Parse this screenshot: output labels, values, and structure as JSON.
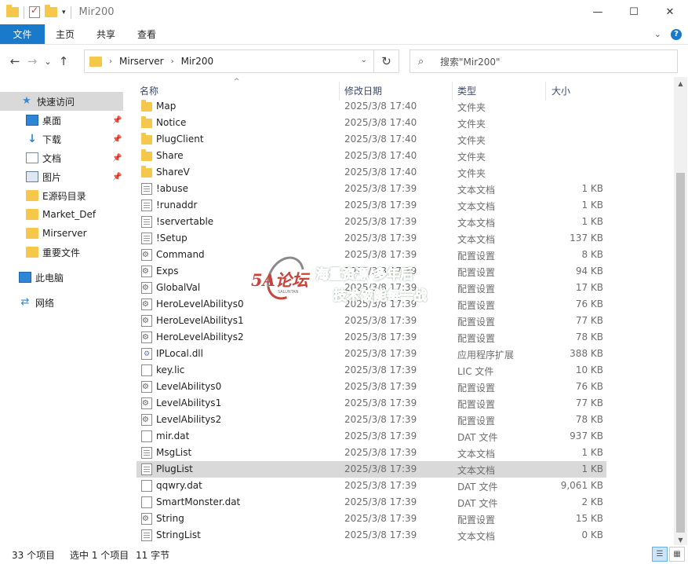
{
  "window": {
    "title": "Mir200",
    "minimize_glyph": "—",
    "maximize_glyph": "☐",
    "close_glyph": "✕"
  },
  "ribbon": {
    "tabs": [
      "文件",
      "主页",
      "共享",
      "查看"
    ],
    "accent_color": "#1979ca",
    "help_label": "?"
  },
  "nav": {
    "back": "←",
    "forward": "→",
    "recent": "⌄",
    "up": "↑"
  },
  "address": {
    "crumbs": [
      "Mirserver",
      "Mir200"
    ],
    "separator": "›"
  },
  "search": {
    "placeholder": "搜索\"Mir200\""
  },
  "sidebar": {
    "quick_access": "快速访问",
    "items": [
      {
        "label": "桌面",
        "icon": "desktop-icon",
        "pinned": true
      },
      {
        "label": "下载",
        "icon": "download-icon",
        "pinned": true
      },
      {
        "label": "文档",
        "icon": "document-icon",
        "pinned": true
      },
      {
        "label": "图片",
        "icon": "picture-icon",
        "pinned": true
      },
      {
        "label": "E源码目录",
        "icon": "folder-icon",
        "pinned": false
      },
      {
        "label": "Market_Def",
        "icon": "folder-icon",
        "pinned": false
      },
      {
        "label": "Mirserver",
        "icon": "folder-icon",
        "pinned": false
      },
      {
        "label": "重要文件",
        "icon": "folder-icon",
        "pinned": false
      }
    ],
    "this_pc": "此电脑",
    "network": "网络"
  },
  "columns": {
    "name": "名称",
    "date": "修改日期",
    "type": "类型",
    "size": "大小"
  },
  "files": [
    {
      "name": "Map",
      "date": "2025/3/8 17:40",
      "type": "文件夹",
      "size": "",
      "icon": "folder"
    },
    {
      "name": "Notice",
      "date": "2025/3/8 17:40",
      "type": "文件夹",
      "size": "",
      "icon": "folder"
    },
    {
      "name": "PlugClient",
      "date": "2025/3/8 17:40",
      "type": "文件夹",
      "size": "",
      "icon": "folder"
    },
    {
      "name": "Share",
      "date": "2025/3/8 17:40",
      "type": "文件夹",
      "size": "",
      "icon": "folder"
    },
    {
      "name": "ShareV",
      "date": "2025/3/8 17:40",
      "type": "文件夹",
      "size": "",
      "icon": "folder"
    },
    {
      "name": "!abuse",
      "date": "2025/3/8 17:39",
      "type": "文本文档",
      "size": "1 KB",
      "icon": "text"
    },
    {
      "name": "!runaddr",
      "date": "2025/3/8 17:39",
      "type": "文本文档",
      "size": "1 KB",
      "icon": "text"
    },
    {
      "name": "!servertable",
      "date": "2025/3/8 17:39",
      "type": "文本文档",
      "size": "1 KB",
      "icon": "text"
    },
    {
      "name": "!Setup",
      "date": "2025/3/8 17:39",
      "type": "文本文档",
      "size": "137 KB",
      "icon": "text"
    },
    {
      "name": "Command",
      "date": "2025/3/8 17:39",
      "type": "配置设置",
      "size": "8 KB",
      "icon": "cfg"
    },
    {
      "name": "Exps",
      "date": "2025/3/8 17:39",
      "type": "配置设置",
      "size": "94 KB",
      "icon": "cfg"
    },
    {
      "name": "GlobalVal",
      "date": "2025/3/8 17:39",
      "type": "配置设置",
      "size": "17 KB",
      "icon": "cfg"
    },
    {
      "name": "HeroLevelAbilitys0",
      "date": "2025/3/8 17:39",
      "type": "配置设置",
      "size": "76 KB",
      "icon": "cfg"
    },
    {
      "name": "HeroLevelAbilitys1",
      "date": "2025/3/8 17:39",
      "type": "配置设置",
      "size": "77 KB",
      "icon": "cfg"
    },
    {
      "name": "HeroLevelAbilitys2",
      "date": "2025/3/8 17:39",
      "type": "配置设置",
      "size": "78 KB",
      "icon": "cfg"
    },
    {
      "name": "IPLocal.dll",
      "date": "2025/3/8 17:39",
      "type": "应用程序扩展",
      "size": "388 KB",
      "icon": "dll"
    },
    {
      "name": "key.lic",
      "date": "2025/3/8 17:39",
      "type": "LIC 文件",
      "size": "10 KB",
      "icon": "file"
    },
    {
      "name": "LevelAbilitys0",
      "date": "2025/3/8 17:39",
      "type": "配置设置",
      "size": "76 KB",
      "icon": "cfg"
    },
    {
      "name": "LevelAbilitys1",
      "date": "2025/3/8 17:39",
      "type": "配置设置",
      "size": "77 KB",
      "icon": "cfg"
    },
    {
      "name": "LevelAbilitys2",
      "date": "2025/3/8 17:39",
      "type": "配置设置",
      "size": "78 KB",
      "icon": "cfg"
    },
    {
      "name": "mir.dat",
      "date": "2025/3/8 17:39",
      "type": "DAT 文件",
      "size": "937 KB",
      "icon": "file"
    },
    {
      "name": "MsgList",
      "date": "2025/3/8 17:39",
      "type": "文本文档",
      "size": "1 KB",
      "icon": "text"
    },
    {
      "name": "PlugList",
      "date": "2025/3/8 17:39",
      "type": "文本文档",
      "size": "1 KB",
      "icon": "text",
      "selected": true
    },
    {
      "name": "qqwry.dat",
      "date": "2025/3/8 17:39",
      "type": "DAT 文件",
      "size": "9,061 KB",
      "icon": "file"
    },
    {
      "name": "SmartMonster.dat",
      "date": "2025/3/8 17:39",
      "type": "DAT 文件",
      "size": "2 KB",
      "icon": "file"
    },
    {
      "name": "String",
      "date": "2025/3/8 17:39",
      "type": "配置设置",
      "size": "15 KB",
      "icon": "cfg"
    },
    {
      "name": "StringList",
      "date": "2025/3/8 17:39",
      "type": "文本文档",
      "size": "0 KB",
      "icon": "text"
    }
  ],
  "status": {
    "item_count": "33 个项目",
    "selected": "选中 1 个项目",
    "selected_size": "11 字节"
  },
  "watermark": {
    "logo": "5A论坛",
    "logo_sub": "SALUNTAN",
    "line1": "海量资源 多年后",
    "line2": "技术破能每一战"
  },
  "colors": {
    "folder": "#f5c84c",
    "selection": "#d9d9d9",
    "accent": "#1979ca"
  }
}
